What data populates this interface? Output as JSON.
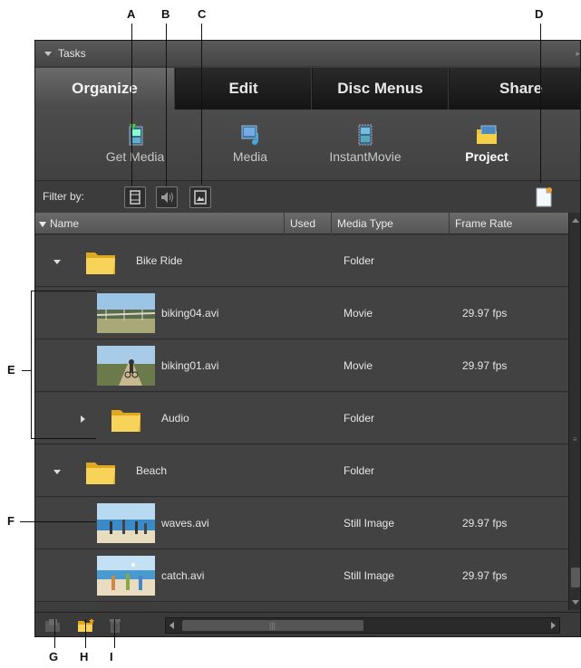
{
  "panel": {
    "title": "Tasks"
  },
  "tabs": [
    {
      "label": "Organize",
      "active": true
    },
    {
      "label": "Edit",
      "active": false
    },
    {
      "label": "Disc Menus",
      "active": false
    },
    {
      "label": "Share",
      "active": false
    }
  ],
  "tools": [
    {
      "label": "Get Media",
      "icon": "get-media-icon"
    },
    {
      "label": "Media",
      "icon": "media-icon"
    },
    {
      "label": "InstantMovie",
      "icon": "instant-movie-icon"
    },
    {
      "label": "Project",
      "icon": "project-icon",
      "active": true
    }
  ],
  "filter": {
    "label": "Filter by:",
    "buttons": [
      "filter-video-icon",
      "filter-audio-icon",
      "filter-still-image-icon"
    ]
  },
  "columns": [
    "Name",
    "Used",
    "Media Type",
    "Frame Rate"
  ],
  "rows": [
    {
      "name": "Bike Ride",
      "type": "Folder",
      "rate": "",
      "kind": "folder",
      "expanded": true,
      "level": 0
    },
    {
      "name": "biking04.avi",
      "type": "Movie",
      "rate": "29.97 fps",
      "kind": "clip",
      "level": 1
    },
    {
      "name": "biking01.avi",
      "type": "Movie",
      "rate": "29.97 fps",
      "kind": "clip",
      "level": 1
    },
    {
      "name": "Audio",
      "type": "Folder",
      "rate": "",
      "kind": "folder",
      "expanded": false,
      "level": 1
    },
    {
      "name": "Beach",
      "type": "Folder",
      "rate": "",
      "kind": "folder",
      "expanded": true,
      "level": 0
    },
    {
      "name": "waves.avi",
      "type": "Still Image",
      "rate": "29.97 fps",
      "kind": "clip",
      "level": 1
    },
    {
      "name": "catch.avi",
      "type": "Still Image",
      "rate": "29.97 fps",
      "kind": "clip",
      "level": 1
    }
  ],
  "bottom_icons": [
    "new-folder-disabled-icon",
    "new-folder-icon",
    "delete-icon"
  ],
  "callouts": [
    "A",
    "B",
    "C",
    "D",
    "E",
    "F",
    "G",
    "H",
    "I"
  ],
  "colors": {
    "folder": "#f2c230",
    "panel_bg": "#3a3a3a",
    "tab_active": "#5a5a5a"
  }
}
